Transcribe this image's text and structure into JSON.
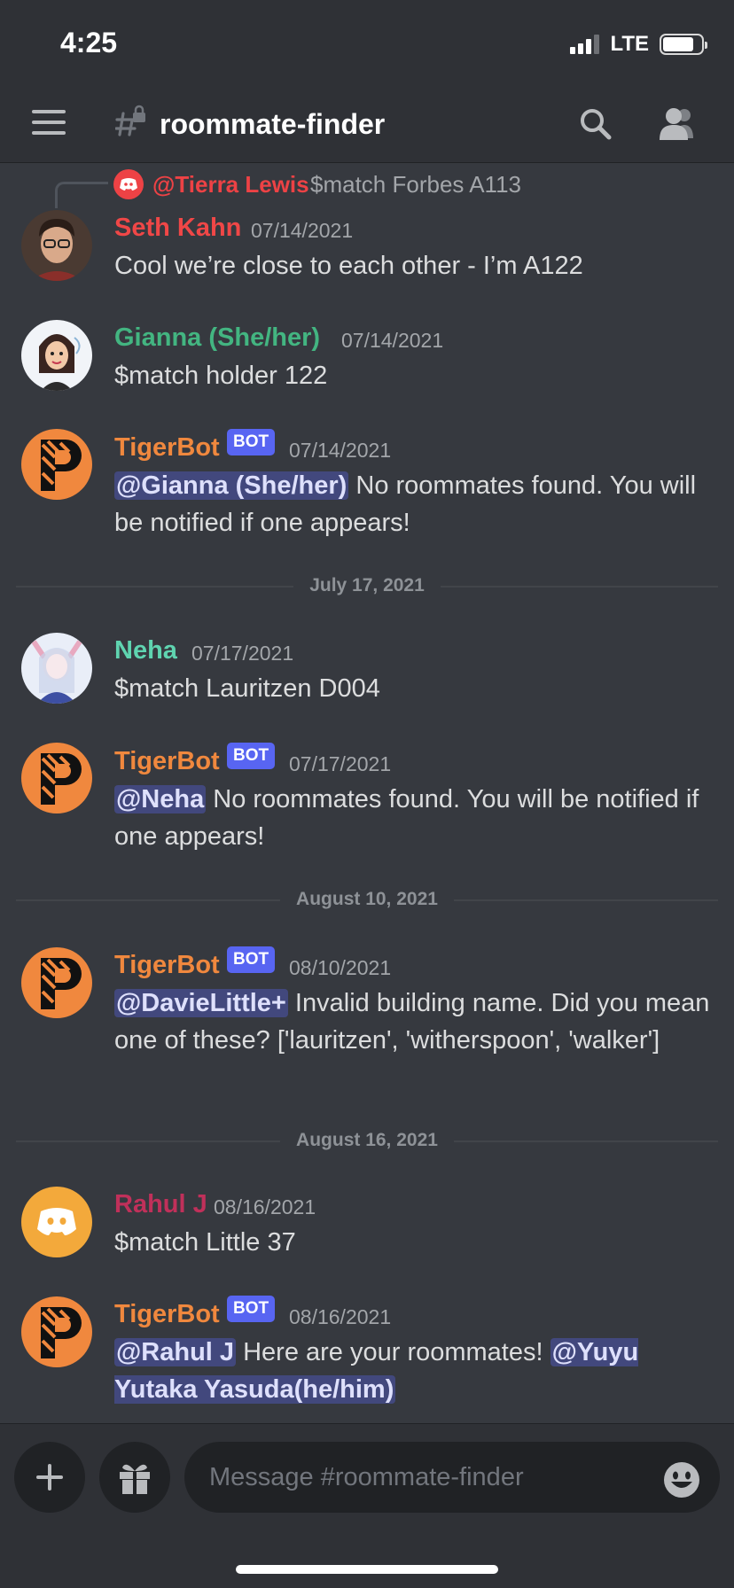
{
  "status_bar": {
    "time": "4:25",
    "network": "LTE",
    "battery_pct": 0.8
  },
  "header": {
    "channel_name": "roommate-finder",
    "icons": [
      "menu-icon",
      "locked-hash-icon",
      "search-icon",
      "members-icon"
    ]
  },
  "reply": {
    "author": "@Tierra Lewis",
    "text": "$match Forbes A113"
  },
  "messages": [
    {
      "author": "Seth Kahn",
      "timestamp": "07/14/2021",
      "text": "Cool we’re close to each other - I’m A122"
    },
    {
      "author": "Gianna (She/her)",
      "timestamp": "07/14/2021",
      "text": "$match holder 122"
    },
    {
      "author": "TigerBot",
      "bot_tag": "BOT",
      "timestamp": "07/14/2021",
      "mention": "@Gianna (She/her)",
      "text": " No roommates found. You will be notified if one appears!"
    },
    {
      "author": "Neha",
      "timestamp": "07/17/2021",
      "text": "$match Lauritzen D004"
    },
    {
      "author": "TigerBot",
      "bot_tag": "BOT",
      "timestamp": "07/17/2021",
      "mention": "@Neha",
      "text": " No roommates found. You will be notified if one appears!"
    },
    {
      "author": "TigerBot",
      "bot_tag": "BOT",
      "timestamp": "08/10/2021",
      "mention": "@DavieLittle+",
      "text": " Invalid building name. Did you mean one of these? ['lauritzen', 'witherspoon', 'walker']"
    },
    {
      "author": "Rahul J",
      "timestamp": "08/16/2021",
      "text": "$match Little 37"
    },
    {
      "author": "TigerBot",
      "bot_tag": "BOT",
      "timestamp": "08/16/2021",
      "mention": "@Rahul J",
      "text": " Here are your roommates! ",
      "mention2": "@Yuyu Yutaka Yasuda(he/him)"
    }
  ],
  "dividers": [
    "July 17, 2021",
    "August 10, 2021",
    "August 16, 2021"
  ],
  "composer": {
    "placeholder": "Message #roommate-finder"
  },
  "colors": {
    "background": "#36393f",
    "header": "#2f3136",
    "seth": "#f04747",
    "gianna": "#43b581",
    "tigerbot": "#f0883e",
    "neha": "#5fd4b0",
    "rahul": "#c0305a",
    "bot_tag": "#5865f2",
    "mention": "#5865f2"
  }
}
